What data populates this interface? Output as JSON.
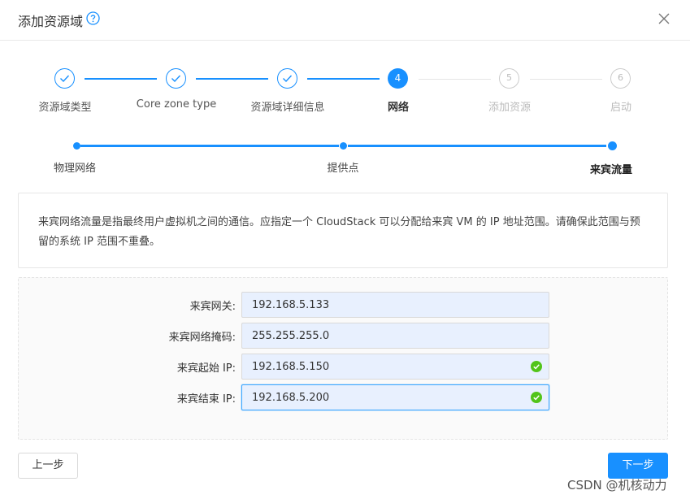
{
  "dialog": {
    "title": "添加资源域"
  },
  "steps": [
    {
      "label": "资源域类型",
      "status": "done"
    },
    {
      "label": "Core zone type",
      "status": "done"
    },
    {
      "label": "资源域详细信息",
      "status": "done"
    },
    {
      "label": "网络",
      "status": "current",
      "number": "4"
    },
    {
      "label": "添加资源",
      "status": "wait",
      "number": "5"
    },
    {
      "label": "启动",
      "status": "wait",
      "number": "6"
    }
  ],
  "substeps": [
    {
      "label": "物理网络"
    },
    {
      "label": "提供点"
    },
    {
      "label": "来宾流量"
    }
  ],
  "info": {
    "text": "来宾网络流量是指最终用户虚拟机之间的通信。应指定一个 CloudStack 可以分配给来宾 VM 的 IP 地址范围。请确保此范围与预留的系统 IP 范围不重叠。"
  },
  "form": {
    "fields": [
      {
        "label": "来宾网关:",
        "value": "192.168.5.133",
        "valid": false
      },
      {
        "label": "来宾网络掩码:",
        "value": "255.255.255.0",
        "valid": false
      },
      {
        "label": "来宾起始 IP:",
        "value": "192.168.5.150",
        "valid": true
      },
      {
        "label": "来宾结束 IP:",
        "value": "192.168.5.200",
        "valid": true
      }
    ]
  },
  "buttons": {
    "prev": "上一步",
    "next": "下一步"
  },
  "watermark": "CSDN @机核动力",
  "colors": {
    "primary": "#1890ff",
    "success": "#52c41a"
  }
}
